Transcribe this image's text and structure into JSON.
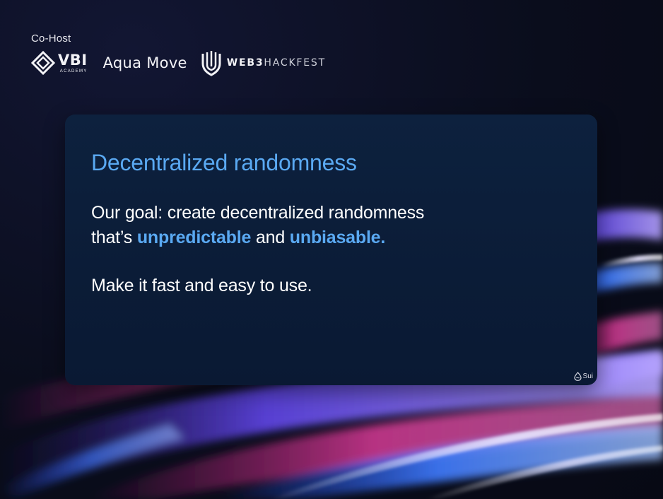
{
  "header": {
    "cohost_label": "Co-Host",
    "logos": [
      {
        "name": "VBI ACADEMY",
        "main": "VBI",
        "sub": "ACADEMY",
        "icon": "vbi-diamond-icon"
      },
      {
        "name": "Aqua Move",
        "text": "Aqua Move"
      },
      {
        "name": "WEB3HACKFEST",
        "bold": "WEB3",
        "light": "HACKFEST",
        "icon": "web3hackfest-shield-icon"
      }
    ]
  },
  "card": {
    "title": "Decentralized randomness",
    "goal_line1": "Our goal: create decentralized randomness",
    "goal_line2_prefix": "that’s ",
    "goal_highlight1": "unpredictable",
    "goal_middle": " and ",
    "goal_highlight2": "unbiasable.",
    "secondary": "Make it fast and easy to use.",
    "badge": {
      "icon": "sui-droplet-icon",
      "text": "Sui"
    }
  },
  "colors": {
    "background": "#0a0d1c",
    "card": "#0c1f3b",
    "accent": "#5aa9f2",
    "text": "#ffffff"
  }
}
